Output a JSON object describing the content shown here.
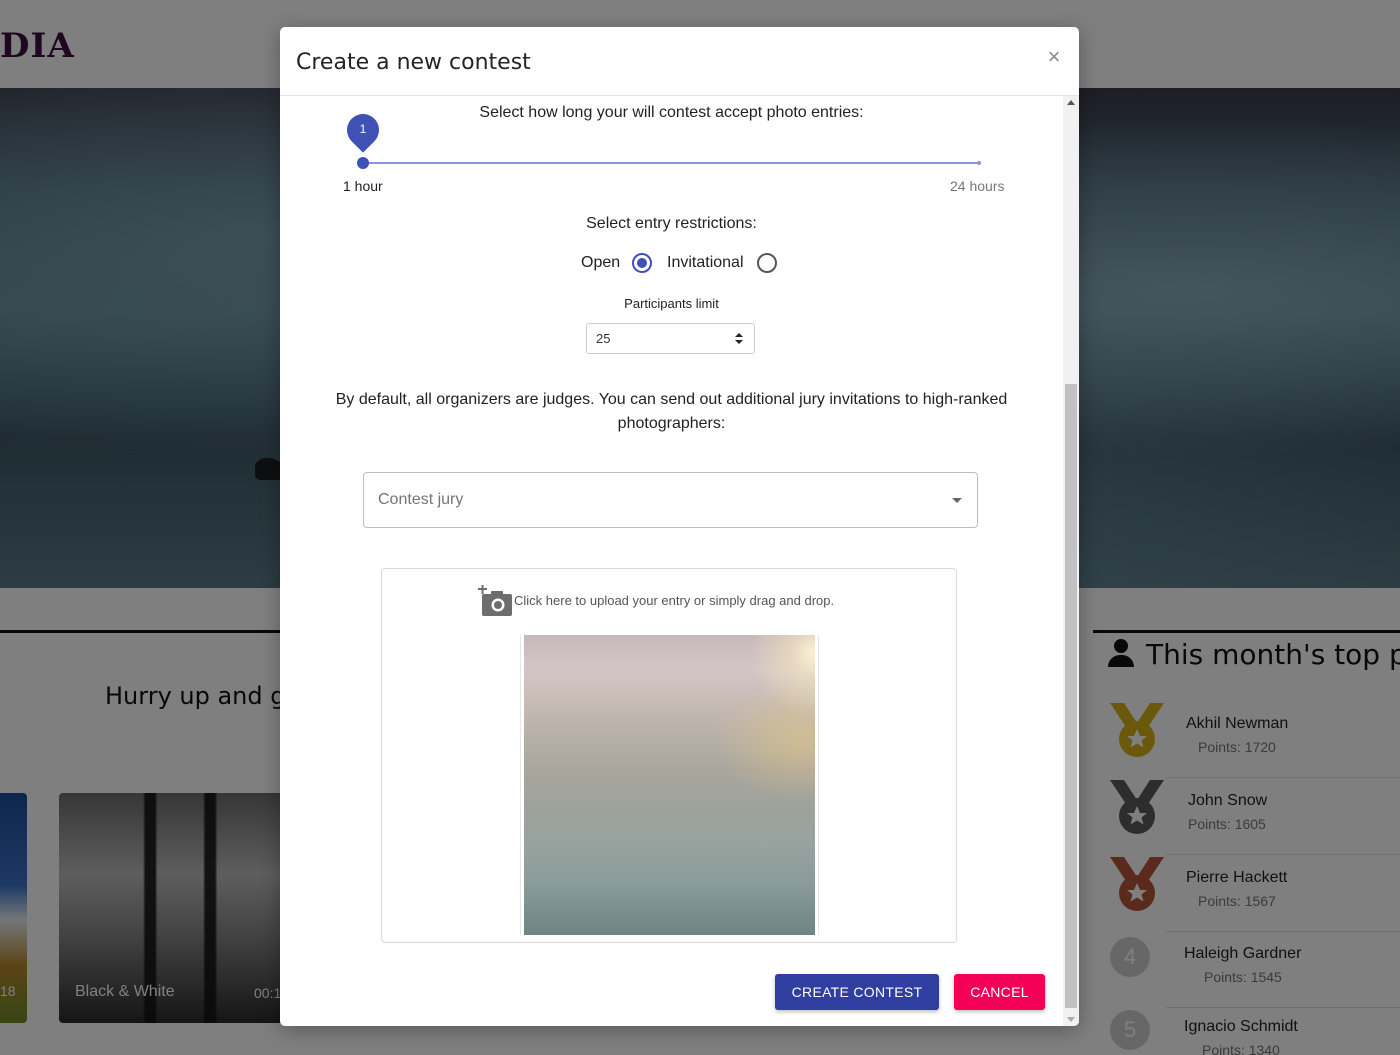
{
  "background": {
    "logo": "DIA",
    "hurry_text": "Hurry up and g",
    "card_a_label": "18",
    "card_b_title": "Black & White",
    "card_b_time": "00:1",
    "top_title": "This month's top p",
    "players": [
      {
        "name": "Akhil Newman",
        "points": "Points: 1720",
        "medal": "gold"
      },
      {
        "name": "John Snow",
        "points": "Points: 1605",
        "medal": "silver"
      },
      {
        "name": "Pierre Hackett",
        "points": "Points: 1567",
        "medal": "bronze"
      },
      {
        "name": "Haleigh Gardner",
        "points": "Points: 1545",
        "rank": "4"
      },
      {
        "name": "Ignacio Schmidt",
        "points": "Points: 1340",
        "rank": "5"
      }
    ]
  },
  "modal": {
    "title": "Create a new contest",
    "close_symbol": "×",
    "duration_label": "Select how long your will contest accept photo entries:",
    "slider": {
      "value": 1,
      "min": 1,
      "max": 24,
      "value_label": "1",
      "min_label": "1 hour",
      "max_label": "24 hours"
    },
    "restrictions_label": "Select entry restrictions:",
    "restrictions": {
      "open_label": "Open",
      "invitational_label": "Invitational",
      "selected": "Open"
    },
    "participants_limit_label": "Participants limit",
    "participants_limit_value": "25",
    "jury_text": "By default, all organizers are judges. You can send out additional jury invitations to high-ranked photographers:",
    "jury_placeholder": "Contest jury",
    "upload_text": "Click here to upload your entry or simply drag and drop.",
    "create_button": "CREATE CONTEST",
    "cancel_button": "CANCEL"
  },
  "colors": {
    "primary": "#3f51b5",
    "create_button": "#303f9f",
    "cancel_button": "#f50057",
    "logo": "#3a1140"
  },
  "icons": {
    "close": "close-icon",
    "camera": "add-photo-icon",
    "person": "person-icon"
  }
}
